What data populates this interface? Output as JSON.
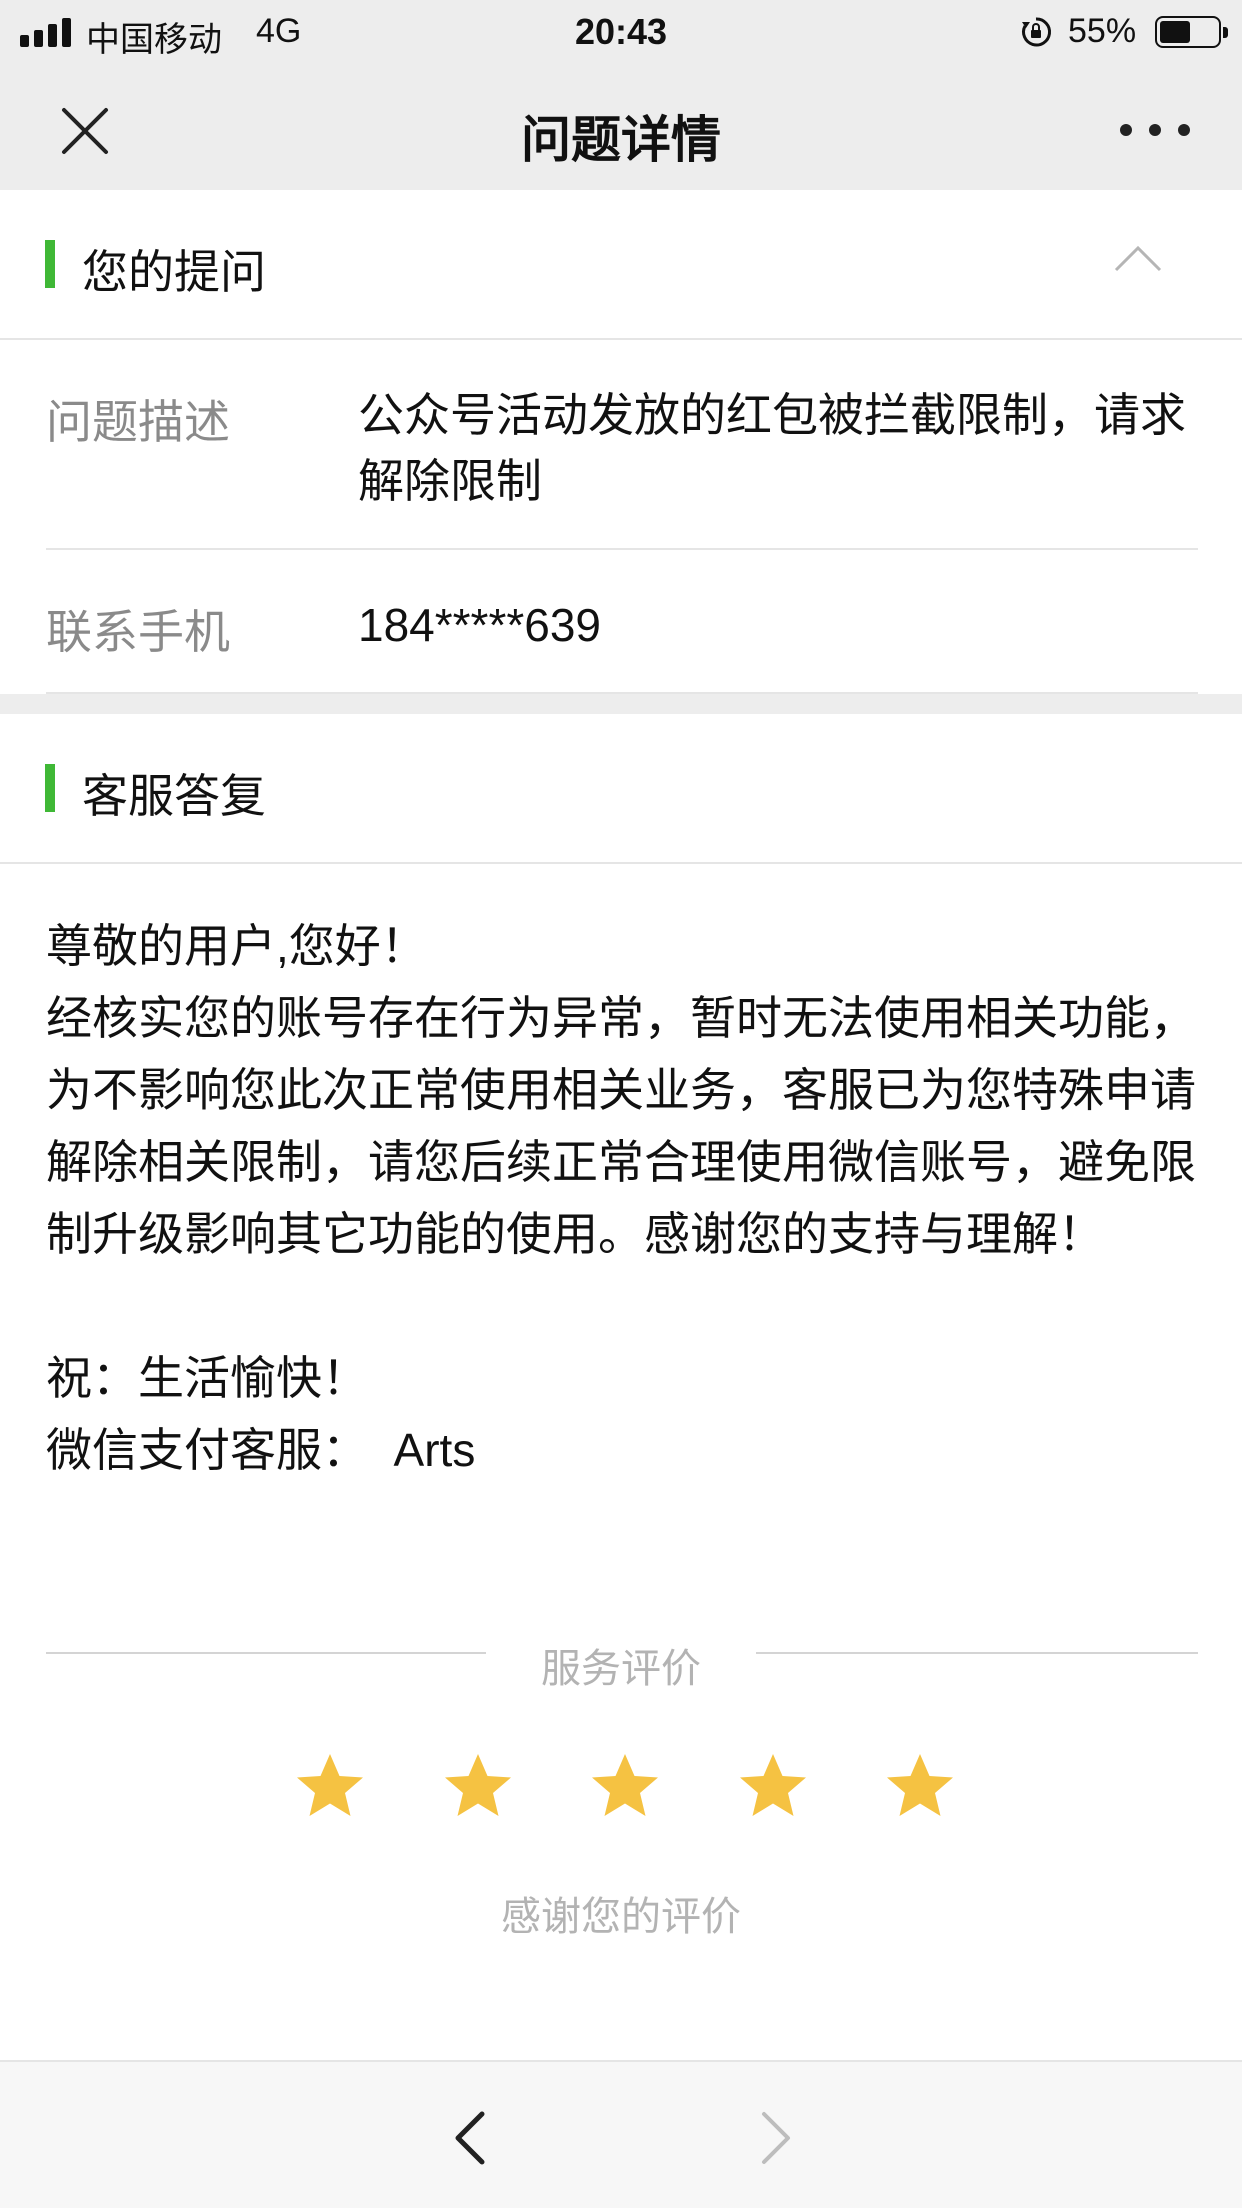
{
  "status_bar": {
    "carrier": "中国移动",
    "network": "4G",
    "time": "20:43",
    "battery": "55%",
    "battery_level": 0.55
  },
  "nav": {
    "title": "问题详情"
  },
  "question": {
    "section_title": "您的提问",
    "description_label": "问题描述",
    "description_value": "公众号活动发放的红包被拦截限制，请求解除限制",
    "phone_label": "联系手机",
    "phone_value": "184*****639"
  },
  "reply": {
    "section_title": "客服答复",
    "greeting": "尊敬的用户,您好！",
    "body": "经核实您的账号存在行为异常，暂时无法使用相关功能，为不影响您此次正常使用相关业务，客服已为您特殊申请解除相关限制，请您后续正常合理使用微信账号，避免限制升级影响其它功能的使用。感谢您的支持与理解！",
    "wish": "祝：生活愉快！",
    "signature": "微信支付客服：  Arts"
  },
  "rating": {
    "label": "服务评价",
    "stars": 5,
    "max_stars": 5,
    "star_color": "#f5c242",
    "thanks": "感谢您的评价"
  },
  "colors": {
    "accent": "#3fb836",
    "header_bg": "#ededed"
  },
  "icons": {
    "close": "close-icon",
    "more": "more-icon",
    "collapse": "chevron-up-icon",
    "star": "star-icon",
    "back": "chevron-left-icon",
    "forward": "chevron-right-icon"
  }
}
